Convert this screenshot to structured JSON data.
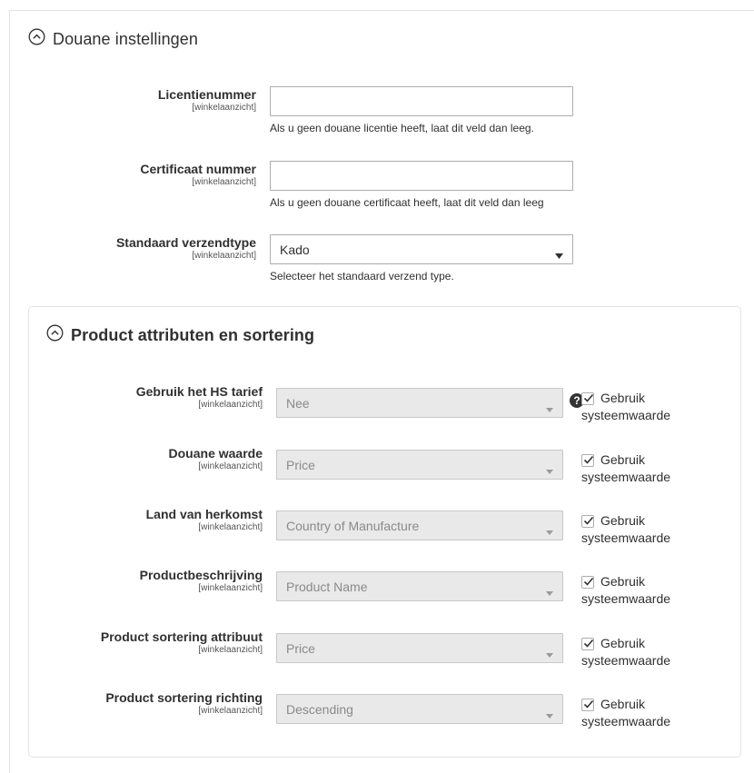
{
  "section": {
    "title": "Douane instellingen",
    "fields": [
      {
        "label": "Licentienummer",
        "scope": "[winkelaanzicht]",
        "value": "",
        "note": "Als u geen douane licentie heeft, laat dit veld dan leeg."
      },
      {
        "label": "Certificaat nummer",
        "scope": "[winkelaanzicht]",
        "value": "",
        "note": "Als u geen douane certificaat heeft, laat dit veld dan leeg"
      },
      {
        "label": "Standaard verzendtype",
        "scope": "[winkelaanzicht]",
        "value": "Kado",
        "note": "Selecteer het standaard verzend type."
      }
    ]
  },
  "subsection": {
    "title": "Product attributen en sortering",
    "rows": [
      {
        "label": "Gebruik het HS tarief",
        "scope": "[winkelaanzicht]",
        "value": "Nee",
        "help": "?",
        "sys_line1": "Gebruik",
        "sys_line2": "systeemwaarde",
        "checked": true
      },
      {
        "label": "Douane waarde",
        "scope": "[winkelaanzicht]",
        "value": "Price",
        "sys_line1": "Gebruik",
        "sys_line2": "systeemwaarde",
        "checked": true
      },
      {
        "label": "Land van herkomst",
        "scope": "[winkelaanzicht]",
        "value": "Country of Manufacture",
        "sys_line1": "Gebruik",
        "sys_line2": "systeemwaarde",
        "checked": true
      },
      {
        "label": "Productbeschrijving",
        "scope": "[winkelaanzicht]",
        "value": "Product Name",
        "sys_line1": "Gebruik",
        "sys_line2": "systeemwaarde",
        "checked": true
      },
      {
        "label": "Product sortering attribuut",
        "scope": "[winkelaanzicht]",
        "value": "Price",
        "sys_line1": "Gebruik",
        "sys_line2": "systeemwaarde",
        "checked": true
      },
      {
        "label": "Product sortering richting",
        "scope": "[winkelaanzicht]",
        "value": "Descending",
        "sys_line1": "Gebruik",
        "sys_line2": "systeemwaarde",
        "checked": true
      }
    ]
  },
  "icons": {
    "collapse": "chevron-up-circle-icon",
    "dropdown": "caret-down-icon",
    "check": "checkmark-icon",
    "help": "question-icon"
  },
  "colors": {
    "text": "#303030",
    "border": "#adadad",
    "disabled_bg": "#e9e9e9",
    "disabled_text": "#8a8a8a",
    "panel_border": "#e3e3e3"
  }
}
